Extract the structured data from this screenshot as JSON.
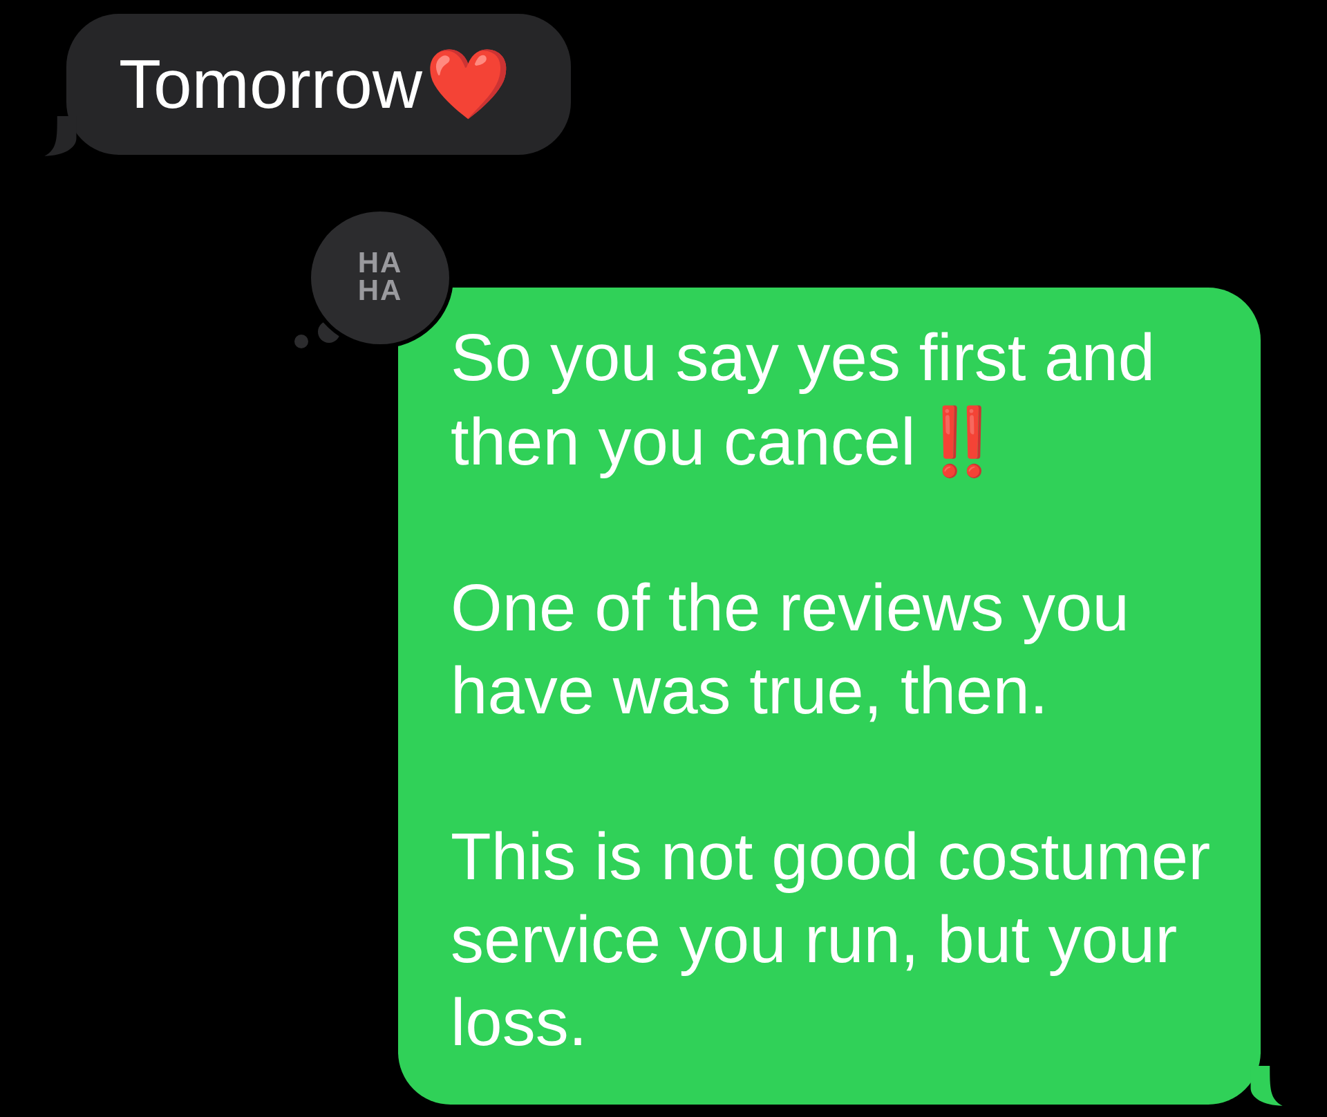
{
  "messages": [
    {
      "kind": "incoming",
      "text": "Tomorrow",
      "emoji": "❤️"
    },
    {
      "kind": "outgoing",
      "tapback": {
        "kind": "haha",
        "text": "HA HA"
      },
      "paragraphs": [
        {
          "text": "So you say yes first and then you cancel",
          "emoji": "‼️"
        },
        {
          "text": "One of the reviews you have was true, then."
        },
        {
          "text": "This is not good costumer service you run, but your loss."
        }
      ]
    }
  ]
}
